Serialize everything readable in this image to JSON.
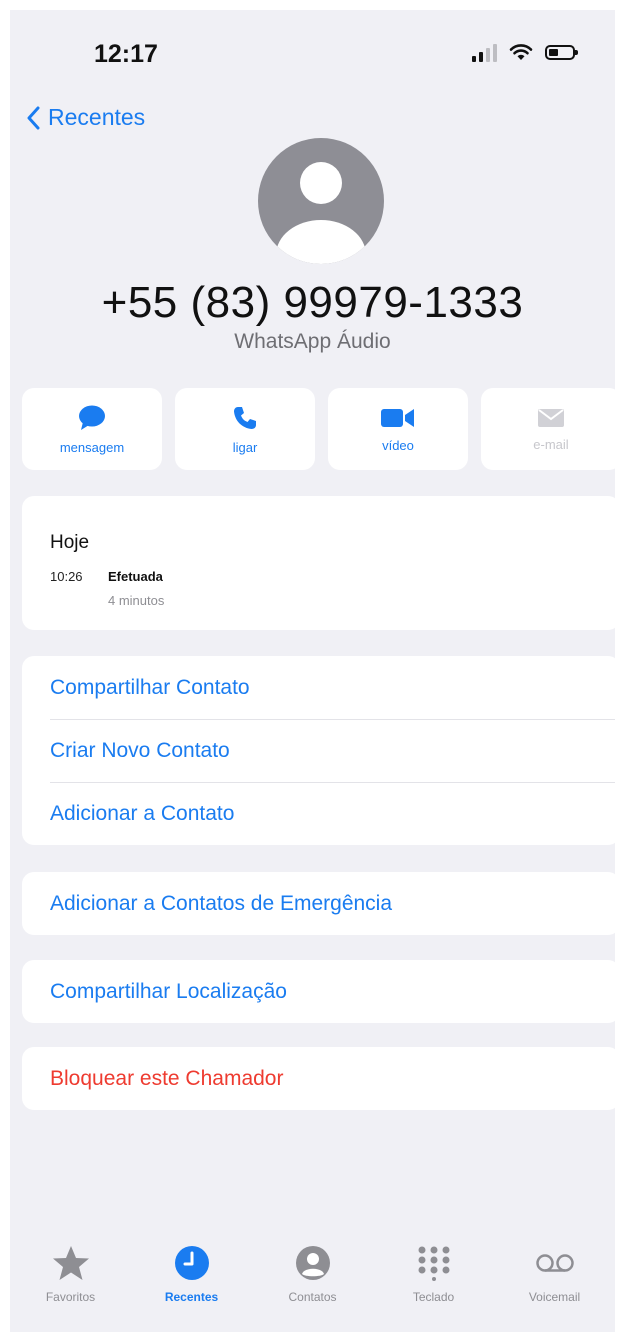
{
  "status": {
    "time": "12:17"
  },
  "nav": {
    "back_label": "Recentes"
  },
  "contact": {
    "number": "+55 (83) 99979-1333",
    "subtitle": "WhatsApp Áudio"
  },
  "actions": [
    {
      "label": "mensagem",
      "icon": "message-icon",
      "enabled": true
    },
    {
      "label": "ligar",
      "icon": "phone-icon",
      "enabled": true
    },
    {
      "label": "vídeo",
      "icon": "video-icon",
      "enabled": true
    },
    {
      "label": "e-mail",
      "icon": "mail-icon",
      "enabled": false
    }
  ],
  "history": {
    "day": "Hoje",
    "time": "10:26",
    "type": "Efetuada",
    "duration": "4 minutos"
  },
  "options": {
    "share_contact": "Compartilhar Contato",
    "create_contact": "Criar Novo Contato",
    "add_to_contact": "Adicionar a Contato",
    "emergency": "Adicionar a Contatos de Emergência",
    "share_location": "Compartilhar Localização",
    "block": "Bloquear este Chamador"
  },
  "tabs": [
    {
      "label": "Favoritos",
      "icon": "star-icon",
      "active": false
    },
    {
      "label": "Recentes",
      "icon": "clock-icon",
      "active": true
    },
    {
      "label": "Contatos",
      "icon": "person-circle-icon",
      "active": false
    },
    {
      "label": "Teclado",
      "icon": "keypad-icon",
      "active": false
    },
    {
      "label": "Voicemail",
      "icon": "voicemail-icon",
      "active": false
    }
  ],
  "colors": {
    "accent": "#1a7cf0",
    "danger": "#ee3b30",
    "background": "#f0f0f5"
  }
}
